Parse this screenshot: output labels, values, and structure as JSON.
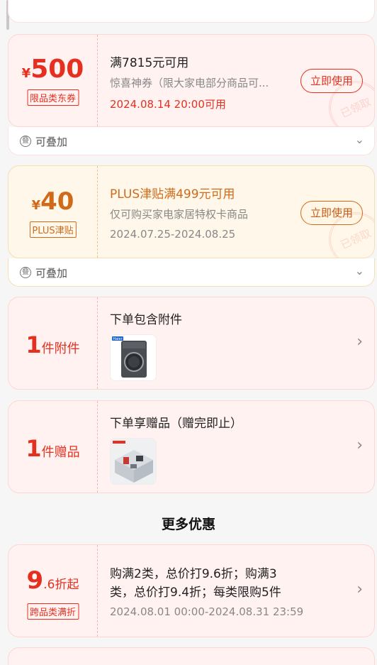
{
  "coupons": [
    {
      "currency": "¥",
      "amount": "500",
      "tag": "限品类东券",
      "title": "满7815元可用",
      "desc": "惊喜神券（限大家电部分商品可...",
      "date": "2024.08.14 20:00可用",
      "button": "立即使用",
      "stamp": "已领取",
      "stack_label": "可叠加"
    },
    {
      "currency": "¥",
      "amount": "40",
      "tag": "PLUS津贴",
      "title": "PLUS津贴满499元可用",
      "desc": "仅可购买家电家居特权卡商品",
      "date": "2024.07.25-2024.08.25",
      "button": "立即使用",
      "stamp": "已领取",
      "stack_label": "可叠加"
    }
  ],
  "extras": [
    {
      "count": "1",
      "unit": "件附件",
      "title": "下单包含附件",
      "thumb_badge": "Haier"
    },
    {
      "count": "1",
      "unit": "件赠品",
      "title": "下单享赠品（赠完即止）"
    }
  ],
  "more": {
    "title": "更多优惠"
  },
  "discount": {
    "big": "9",
    "small": ".6折起",
    "tag": "跨品类满折",
    "title_line1": "购满2类，总价打9.6折；购满3",
    "title_line2": "类，总价打9.4折；每类限购5件",
    "date": "2024.08.01 00:00-2024.08.31 23:59"
  },
  "icons": {
    "stack": "stack-icon",
    "chevron": "chevron-down-icon",
    "arrow": "chevron-right-icon"
  },
  "colors": {
    "red": "#e6301f",
    "orange": "#d06a1b",
    "pink_bg": "#fff2f1",
    "gold_bg": "#fff8ea"
  }
}
